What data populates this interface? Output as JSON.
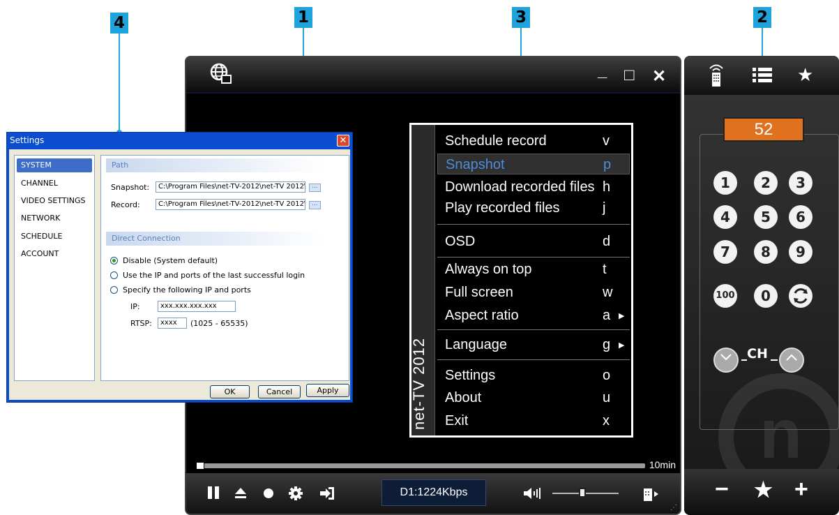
{
  "callouts": [
    "1",
    "2",
    "3",
    "4"
  ],
  "player": {
    "window_controls": [
      "_",
      "□",
      "✕"
    ],
    "duration": "10min",
    "bitrate": "D1:1224Kbps",
    "playback_progress": 0.0
  },
  "menu": {
    "side_label": "net-TV 2012",
    "items": [
      {
        "label": "Schedule record",
        "key": "v"
      },
      {
        "label": "Snapshot",
        "key": "p"
      },
      {
        "label": "Download recorded files",
        "key": "h"
      },
      {
        "label": "Play recorded files",
        "key": "j"
      },
      {
        "label": "OSD",
        "key": "d"
      },
      {
        "label": "Always on top",
        "key": "t"
      },
      {
        "label": "Full screen",
        "key": "w"
      },
      {
        "label": "Aspect ratio",
        "key": "a"
      },
      {
        "label": "Language",
        "key": "g"
      },
      {
        "label": "Settings",
        "key": "o"
      },
      {
        "label": "About",
        "key": "u"
      },
      {
        "label": "Exit",
        "key": "x"
      }
    ]
  },
  "remote": {
    "channel": "52",
    "keys": [
      "1",
      "2",
      "3",
      "4",
      "5",
      "6",
      "7",
      "8",
      "9",
      "100",
      "0"
    ],
    "ch_label": "CH",
    "bottom": [
      "−",
      "★",
      "+"
    ]
  },
  "settings": {
    "title": "Settings",
    "nav": [
      "SYSTEM",
      "CHANNEL",
      "VIDEO SETTINGS",
      "NETWORK",
      "SCHEDULE",
      "ACCOUNT"
    ],
    "path_header": "Path",
    "snapshot_label": "Snapshot:",
    "snapshot_value": "C:\\Program Files\\net-TV-2012\\net-TV 2012\\",
    "record_label": "Record:",
    "record_value": "C:\\Program Files\\net-TV-2012\\net-TV 2012\\",
    "browse": "...",
    "direct_header": "Direct Connection",
    "options": [
      "Disable (System default)",
      "Use the IP and ports of the last successful login",
      "Specify the following IP and ports"
    ],
    "ip_label": "IP:",
    "ip_value": "xxx.xxx.xxx.xxx",
    "rtsp_label": "RTSP:",
    "rtsp_value": "xxxx",
    "rtsp_range": "(1025 - 65535)",
    "ok": "OK",
    "cancel": "Cancel",
    "apply": "Apply"
  }
}
